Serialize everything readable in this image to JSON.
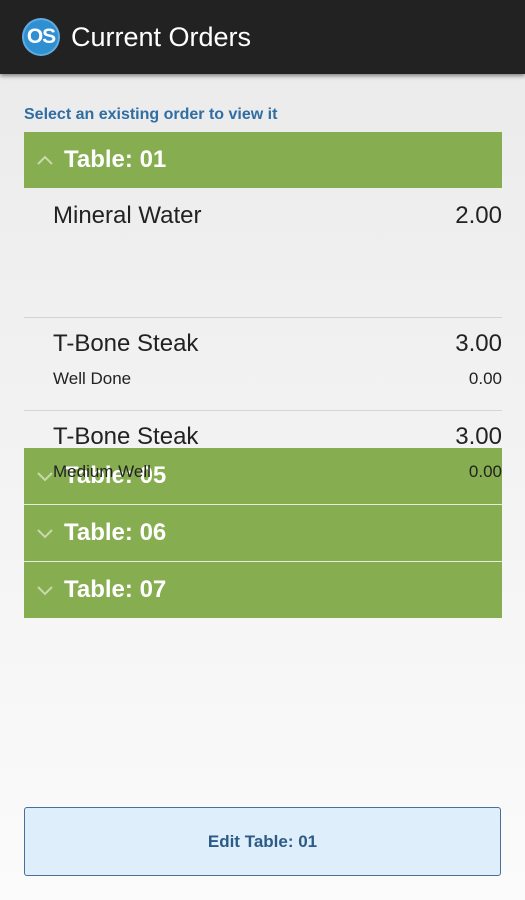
{
  "header": {
    "logo_text": "OS",
    "title": "Current Orders"
  },
  "hint": "Select an existing order to view it",
  "tables": [
    {
      "label": "Table: 01",
      "expanded": true,
      "items": [
        {
          "name": "Mineral Water",
          "price": "2.00"
        },
        {
          "name": "T-Bone Steak",
          "price": "3.00",
          "modifier": "Well Done",
          "modifier_price": "0.00"
        },
        {
          "name": "T-Bone Steak",
          "price": "3.00",
          "modifier": "Medium Well",
          "modifier_price": "0.00"
        }
      ]
    },
    {
      "label": "Table: 05",
      "expanded": false
    },
    {
      "label": "Table: 06",
      "expanded": false
    },
    {
      "label": "Table: 07",
      "expanded": false
    }
  ],
  "edit_button_label": "Edit Table: 01",
  "icons": {
    "collapse": "chevron-up-icon",
    "expand": "chevron-down-icon"
  },
  "colors": {
    "header_bg": "#222222",
    "table_header_bg": "#86ad4f",
    "hint_text": "#2f6da3",
    "edit_button_bg": "#deeefb",
    "logo_bg": "#2f8fd3"
  }
}
